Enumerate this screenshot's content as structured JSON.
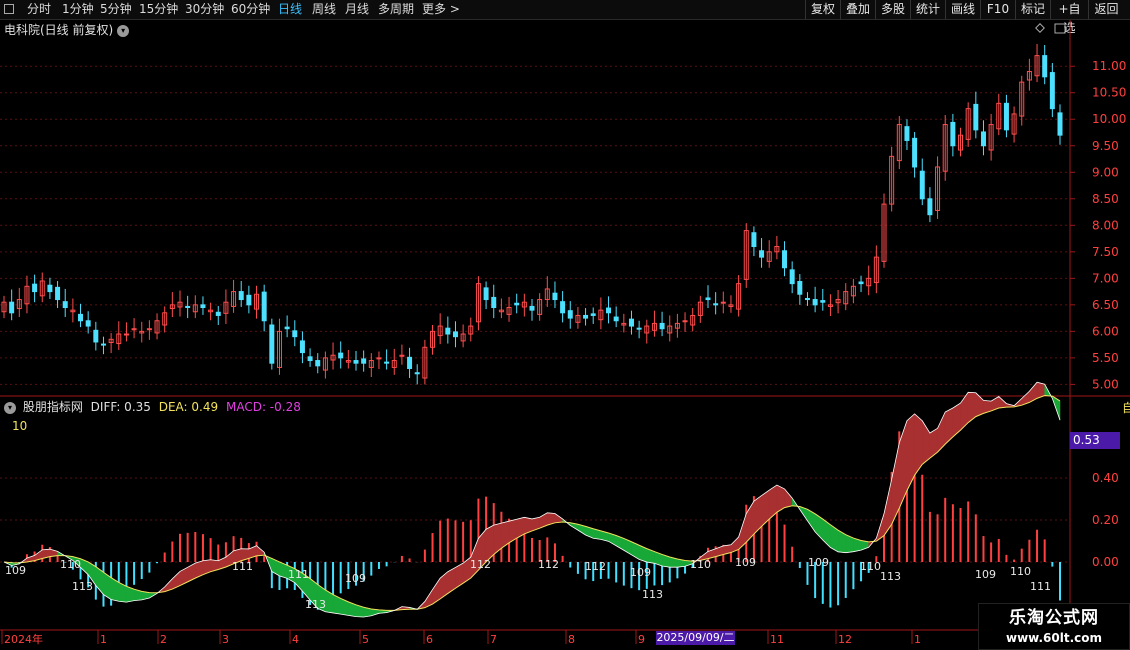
{
  "toolbar": {
    "periods": [
      "分时",
      "1分钟",
      "5分钟",
      "15分钟",
      "30分钟",
      "60分钟",
      "日线",
      "周线",
      "月线",
      "多周期",
      "更多 >"
    ],
    "active_period": "日线",
    "actions": [
      "复权",
      "叠加",
      "多股",
      "统计",
      "画线",
      "F10",
      "标记",
      "+自选",
      "返回"
    ]
  },
  "main_chart": {
    "title": "电科院(日线 前复权)",
    "y_ticks": [
      "11.00",
      "10.50",
      "10.00",
      "9.50",
      "9.00",
      "8.50",
      "8.00",
      "7.50",
      "7.00",
      "6.50",
      "6.00",
      "5.50",
      "5.00"
    ],
    "up_color": "#ff4d4d",
    "down_color": "#4de0ff"
  },
  "indicator": {
    "name": "股朋指标网",
    "diff_label": "DIFF: 0.35",
    "dea_label": "DEA: 0.49",
    "macd_label": "MACD: -0.28",
    "param": "10",
    "current_value": "0.53",
    "y_ticks": [
      "0.40",
      "0.20",
      "0.00"
    ],
    "markers": [
      "109",
      "110",
      "111",
      "112",
      "113"
    ]
  },
  "date_axis": {
    "labels": [
      "2024年",
      "1",
      "2",
      "3",
      "4",
      "5",
      "6",
      "7",
      "8",
      "9",
      "2025/09/09/二",
      "11",
      "12",
      "1"
    ],
    "highlight": "2025/09/09/二"
  },
  "right_edge_text": "自",
  "watermark": {
    "title": "乐淘公式网",
    "url": "www.60lt.com"
  },
  "chart_data": {
    "type": "candlestick",
    "ylim": [
      4.8,
      11.4
    ],
    "macd_ylim": [
      -0.3,
      0.75
    ],
    "close": [
      6.55,
      6.35,
      6.6,
      6.85,
      6.75,
      6.95,
      6.75,
      6.6,
      6.45,
      6.4,
      6.2,
      6.1,
      5.8,
      5.75,
      5.85,
      5.95,
      5.95,
      6.05,
      6.0,
      6.05,
      6.2,
      6.35,
      6.5,
      6.55,
      6.45,
      6.5,
      6.45,
      6.4,
      6.3,
      6.55,
      6.75,
      6.6,
      6.5,
      6.7,
      6.2,
      5.4,
      6.0,
      6.05,
      5.9,
      5.6,
      5.45,
      5.35,
      5.5,
      5.55,
      5.5,
      5.45,
      5.4,
      5.4,
      5.45,
      5.5,
      5.4,
      5.45,
      5.55,
      5.3,
      5.2,
      5.7,
      6.0,
      6.1,
      5.95,
      5.9,
      5.95,
      6.1,
      6.9,
      6.6,
      6.45,
      6.4,
      6.45,
      6.5,
      6.55,
      6.4,
      6.6,
      6.8,
      6.6,
      6.35,
      6.25,
      6.3,
      6.25,
      6.3,
      6.4,
      6.35,
      6.2,
      6.15,
      6.1,
      6.05,
      6.1,
      6.15,
      6.05,
      6.1,
      6.15,
      6.2,
      6.3,
      6.55,
      6.6,
      6.5,
      6.55,
      6.5,
      6.9,
      7.9,
      7.6,
      7.4,
      7.5,
      7.6,
      7.2,
      6.9,
      6.7,
      6.6,
      6.5,
      6.55,
      6.5,
      6.6,
      6.75,
      6.85,
      6.9,
      7.0,
      7.4,
      8.4,
      9.3,
      9.9,
      9.6,
      9.1,
      8.5,
      8.2,
      9.1,
      9.9,
      9.5,
      9.7,
      10.2,
      9.8,
      9.5,
      9.9,
      10.3,
      9.8,
      10.1,
      10.7,
      10.9,
      11.2,
      10.8,
      10.2,
      9.7
    ]
  }
}
